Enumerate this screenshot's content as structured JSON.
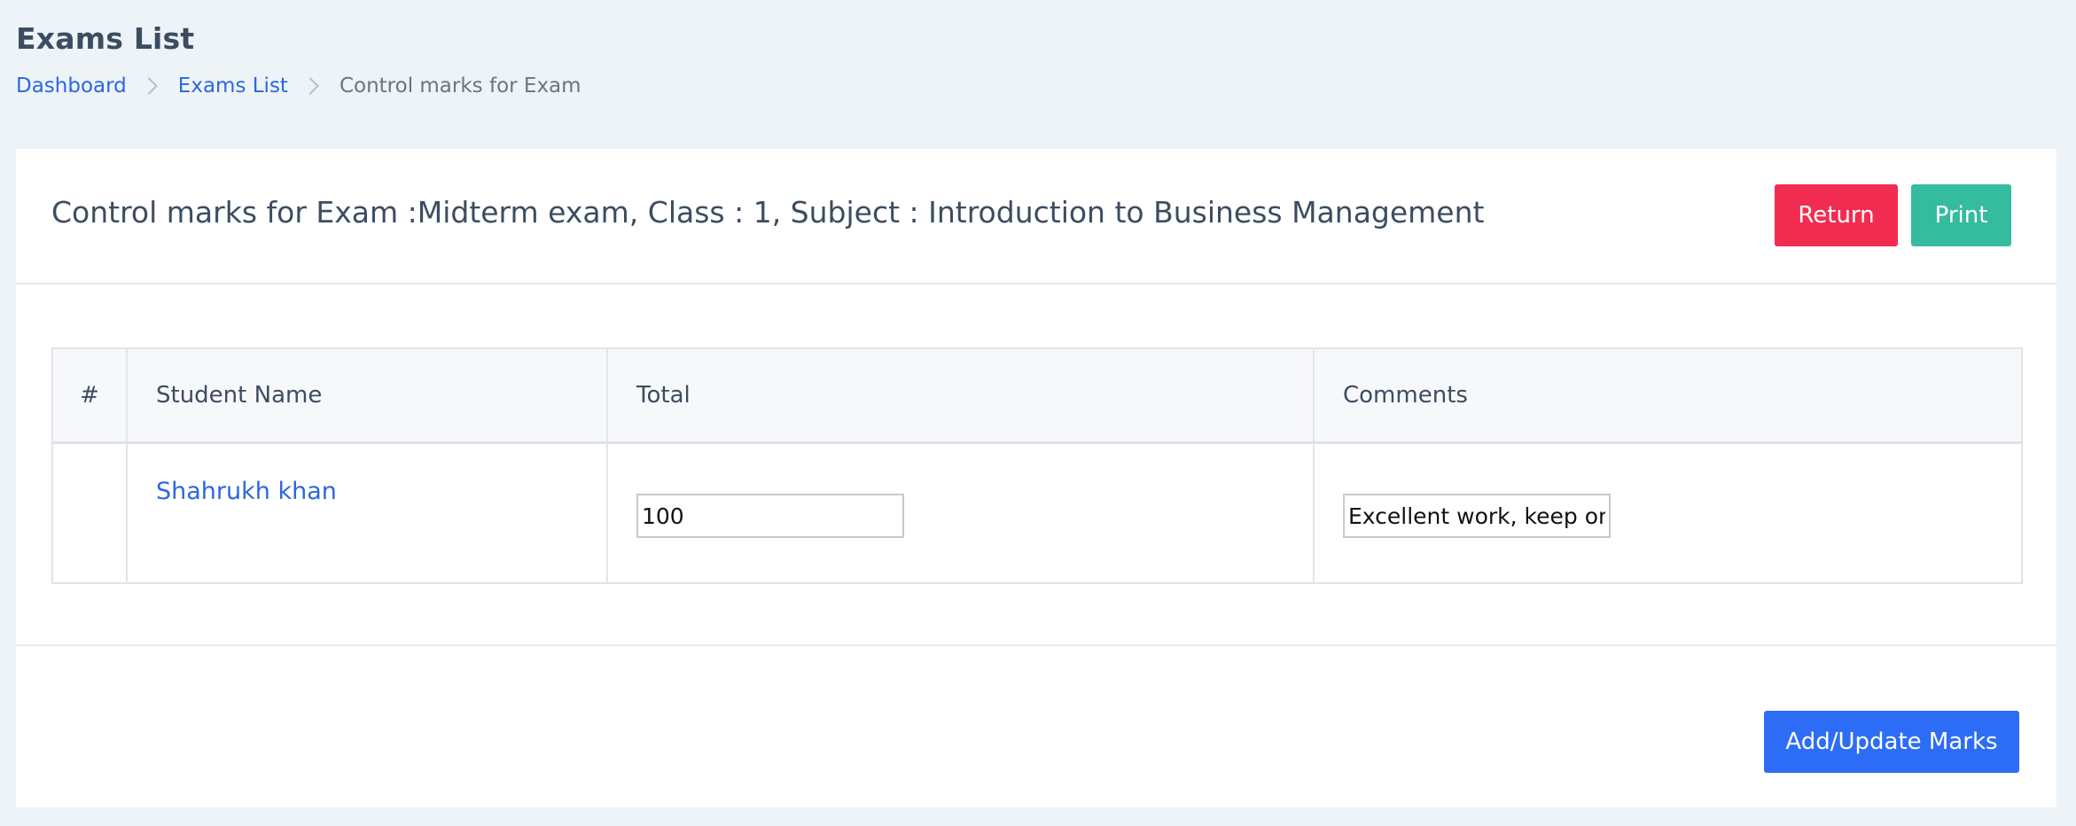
{
  "page": {
    "title": "Exams List"
  },
  "breadcrumb": {
    "items": [
      "Dashboard",
      "Exams List"
    ],
    "current": "Control marks for Exam"
  },
  "card": {
    "title": "Control marks for Exam :Midterm exam, Class : 1, Subject : Introduction to Business Management",
    "return_label": "Return",
    "print_label": "Print",
    "submit_label": "Add/Update Marks"
  },
  "table": {
    "headers": [
      "#",
      "Student Name",
      "Total",
      "Comments"
    ],
    "rows": [
      {
        "index": "",
        "student_name": "Shahrukh khan",
        "total": "100",
        "comment": "Excellent work, keep on"
      }
    ]
  },
  "colors": {
    "background": "#edf3f7",
    "link": "#2d67de",
    "return_button": "#f22c51",
    "print_button": "#35bb9d",
    "submit_button": "#2d6df6"
  }
}
